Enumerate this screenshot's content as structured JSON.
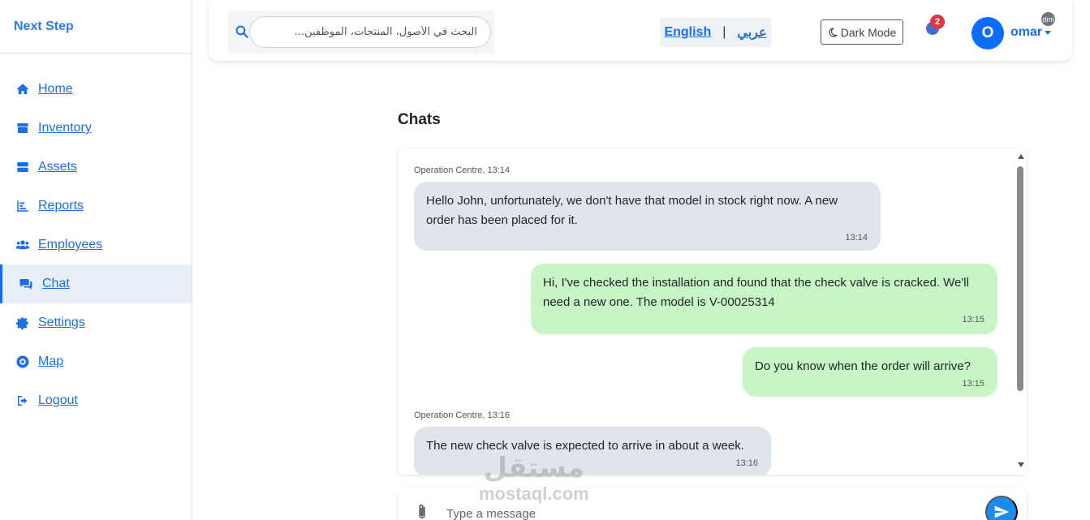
{
  "brand": "Next Step",
  "sidebar": {
    "items": [
      {
        "label": "Home",
        "icon": "home-icon"
      },
      {
        "label": "Inventory",
        "icon": "box-icon"
      },
      {
        "label": "Assets",
        "icon": "server-icon"
      },
      {
        "label": "Reports",
        "icon": "chart-icon"
      },
      {
        "label": "Employees",
        "icon": "users-icon"
      },
      {
        "label": "Chat",
        "icon": "comments-icon",
        "active": true
      },
      {
        "label": "Settings",
        "icon": "gear-icon"
      },
      {
        "label": "Map",
        "icon": "lifebuoy-icon"
      },
      {
        "label": "Logout",
        "icon": "logout-icon"
      }
    ]
  },
  "header": {
    "search_placeholder": "البحث في الأصول، المنتجات، الموظفين...",
    "lang_en": "English",
    "lang_sep": "|",
    "lang_ar": "عربي",
    "dark_mode": "Dark Mode",
    "notification_count": "2",
    "avatar_letter": "O",
    "user_name": "omar",
    "admin_badge": "dmi"
  },
  "chat": {
    "title": "Chats",
    "messages": [
      {
        "direction": "in",
        "sender": "Operation Centre, 13:14",
        "text": "Hello John, unfortunately, we don't have that model in stock right now. A new order has been placed for it.",
        "time": "13:14"
      },
      {
        "direction": "out",
        "text": "Hi, I've checked the installation and found that the check valve is cracked. We'll need a new one. The model is V-00025314",
        "time": "13:15"
      },
      {
        "direction": "out",
        "text": "Do you know when the order will arrive?",
        "time": "13:15"
      },
      {
        "direction": "in",
        "sender": "Operation Centre, 13:16",
        "text": "The new check valve is expected to arrive in about a week.",
        "time": "13:16"
      }
    ],
    "input_placeholder": "Type a message"
  },
  "watermark": {
    "ar": "مستقل",
    "en": "mostaql.com"
  },
  "colors": {
    "accent": "#1a6fe8",
    "incoming_bubble": "#e0e5ec",
    "outgoing_bubble": "#c8f5c5",
    "badge": "#dc3545"
  }
}
